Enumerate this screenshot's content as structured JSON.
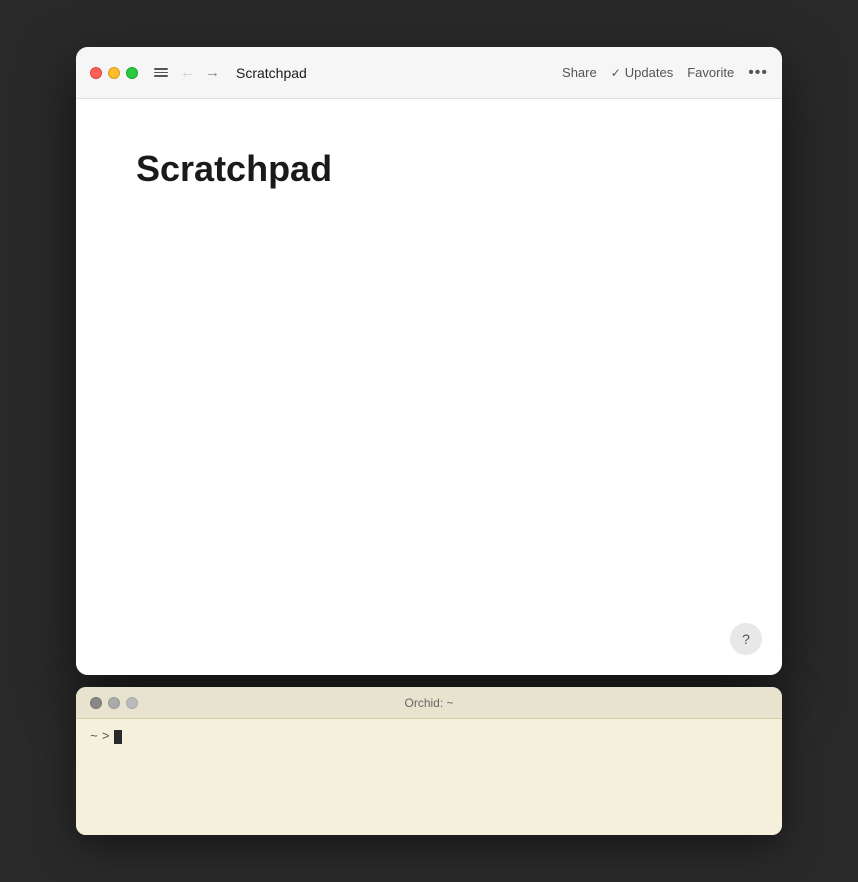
{
  "desktop": {
    "background": "#2a2a2a"
  },
  "scratchpad_window": {
    "title": "Scratchpad",
    "traffic_lights": {
      "close_label": "close",
      "min_label": "minimize",
      "max_label": "maximize"
    },
    "titlebar": {
      "share_label": "Share",
      "updates_label": "Updates",
      "favorite_label": "Favorite",
      "more_label": "•••"
    },
    "content": {
      "doc_title": "Scratchpad"
    },
    "help_label": "?"
  },
  "terminal_window": {
    "title": "Orchid: ~",
    "traffic_lights": {
      "close_label": "close",
      "min_label": "minimize",
      "max_label": "maximize"
    },
    "prompt": {
      "tilde": "~",
      "arrow": ">",
      "cursor": ""
    }
  }
}
